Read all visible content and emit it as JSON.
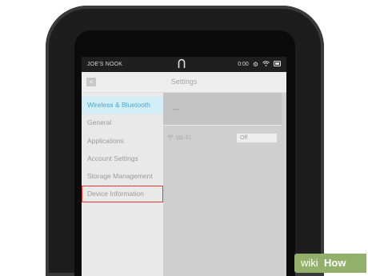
{
  "status_bar": {
    "device_name": "JOE'S NOOK",
    "time": "0:00"
  },
  "title_bar": {
    "title": "Settings"
  },
  "sidebar": {
    "items": [
      {
        "label": "Wireless & Bluetooth"
      },
      {
        "label": "General"
      },
      {
        "label": "Applications"
      },
      {
        "label": "Account Settings"
      },
      {
        "label": "Storage Management"
      },
      {
        "label": "Device Information"
      }
    ]
  },
  "panel": {
    "wifi_label": "Wi-Fi",
    "wifi_value": "Off"
  },
  "watermark": {
    "wiki": "wiki",
    "how": "How"
  },
  "colors": {
    "accent": "#4aa8c8",
    "highlight_box": "#e03a3a",
    "watermark_green": "#93b06b"
  }
}
